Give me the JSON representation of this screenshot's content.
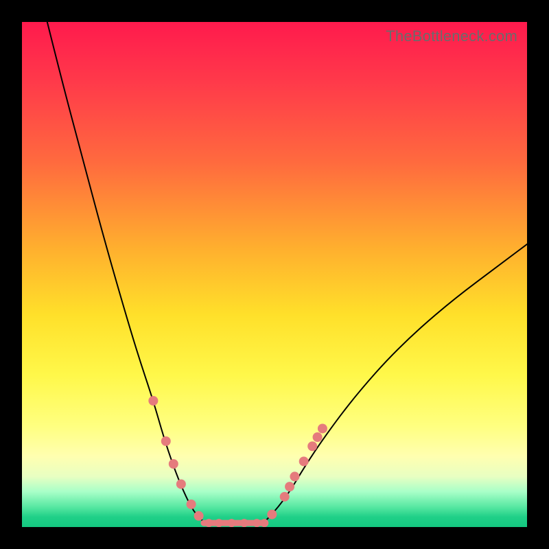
{
  "watermark": "TheBottleneck.com",
  "colors": {
    "dot": "#e57b7d",
    "curve": "#000000",
    "frame": "#000000"
  },
  "chart_data": {
    "type": "line",
    "title": "",
    "xlabel": "",
    "ylabel": "",
    "xlim": [
      0,
      100
    ],
    "ylim": [
      0,
      100
    ],
    "grid": false,
    "legend": false,
    "series": [
      {
        "name": "left-curve",
        "x": [
          5,
          8,
          12,
          16,
          20,
          23,
          26,
          28,
          30,
          32,
          34,
          36
        ],
        "y": [
          100,
          88,
          73,
          58,
          44,
          34,
          25,
          18,
          12,
          7,
          3,
          1
        ]
      },
      {
        "name": "right-curve",
        "x": [
          48,
          50,
          53,
          56,
          60,
          66,
          74,
          84,
          96,
          100
        ],
        "y": [
          1,
          3,
          7,
          12,
          18,
          26,
          35,
          44,
          53,
          56
        ]
      },
      {
        "name": "flat-min",
        "x": [
          36,
          48
        ],
        "y": [
          0.8,
          0.8
        ]
      }
    ],
    "markers_left": [
      {
        "x": 26.0,
        "y": 25.0
      },
      {
        "x": 28.5,
        "y": 17.0
      },
      {
        "x": 30.0,
        "y": 12.5
      },
      {
        "x": 31.5,
        "y": 8.5
      },
      {
        "x": 33.5,
        "y": 4.5
      },
      {
        "x": 35.0,
        "y": 2.2
      }
    ],
    "markers_right": [
      {
        "x": 49.5,
        "y": 2.5
      },
      {
        "x": 52.0,
        "y": 6.0
      },
      {
        "x": 53.0,
        "y": 8.0
      },
      {
        "x": 54.0,
        "y": 10.0
      },
      {
        "x": 55.8,
        "y": 13.0
      },
      {
        "x": 57.5,
        "y": 16.0
      },
      {
        "x": 58.5,
        "y": 17.8
      },
      {
        "x": 59.5,
        "y": 19.5
      }
    ],
    "markers_flat": [
      {
        "x": 37.0,
        "y": 0.8
      },
      {
        "x": 39.0,
        "y": 0.8
      },
      {
        "x": 41.5,
        "y": 0.8
      },
      {
        "x": 44.0,
        "y": 0.8
      },
      {
        "x": 46.5,
        "y": 0.8
      },
      {
        "x": 48.0,
        "y": 0.8
      }
    ]
  }
}
